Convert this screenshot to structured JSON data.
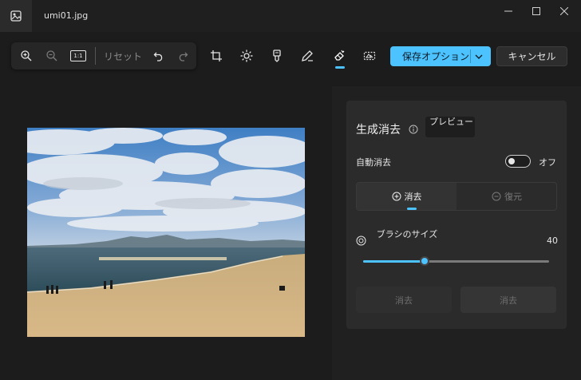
{
  "window": {
    "file_name": "umi01.jpg",
    "app_icon": "photos-app-icon",
    "controls": [
      "minimize-icon",
      "maximize-icon",
      "close-icon"
    ]
  },
  "toolbar": {
    "zoom_in_icon": "zoom-in-icon",
    "zoom_out_icon": "zoom-out-icon",
    "actual_size_label": "1:1",
    "reset_label": "リセット",
    "undo_icon": "undo-icon",
    "redo_icon": "redo-icon"
  },
  "tools": [
    {
      "name": "crop-icon"
    },
    {
      "name": "adjust-icon"
    },
    {
      "name": "filter-icon"
    },
    {
      "name": "markup-icon"
    },
    {
      "name": "erase-icon",
      "active": true
    },
    {
      "name": "background-icon"
    }
  ],
  "actions": {
    "save_label": "保存オプション",
    "cancel_label": "キャンセル"
  },
  "panel": {
    "title": "生成消去",
    "preview_badge": "プレビュー",
    "auto_erase_label": "自動消去",
    "auto_erase_state": "オフ",
    "mode_erase_label": "消去",
    "mode_restore_label": "復元",
    "brush_size_label": "ブラシのサイズ",
    "brush_size_value": "40",
    "brush_size_fraction": 0.33,
    "button_a_label": "消去",
    "button_b_label": "消去"
  },
  "colors": {
    "accent": "#4cc2ff",
    "background": "#1c1c1c",
    "panel": "#2b2b2b"
  }
}
